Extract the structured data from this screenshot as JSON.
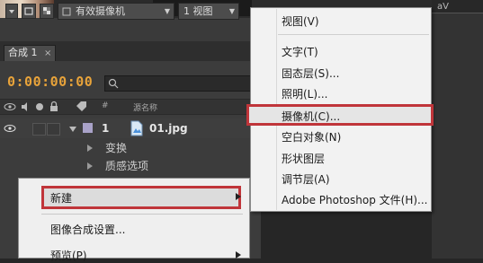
{
  "viewer_toolbar": {
    "camera_select": "有效摄像机",
    "view_select": "1 视图"
  },
  "comp_tab": {
    "label": "合成 1",
    "close": "×"
  },
  "timeline": {
    "timecode": "0:00:00:00",
    "header": {
      "number": "#",
      "source_name": "源名称"
    },
    "layer": {
      "number": "1",
      "name": "01.jpg"
    },
    "sub_items": [
      "变换",
      "质感选项"
    ]
  },
  "context_menu": {
    "items": [
      {
        "label": "新建",
        "has_submenu": true,
        "highlighted": true
      },
      {
        "label": "图像合成设置...",
        "has_submenu": false
      },
      {
        "label": "预览(P)",
        "has_submenu": true
      }
    ]
  },
  "submenu": {
    "items": [
      "视图(V)",
      "文字(T)",
      "固态层(S)...",
      "照明(L)...",
      "摄像机(C)...",
      "空白对象(N)",
      "形状图层",
      "调节层(A)",
      "Adobe Photoshop 文件(H)..."
    ],
    "highlighted_index": 4
  },
  "right_panel": {
    "label": "aV"
  },
  "colors": {
    "highlight_border": "#c0353a",
    "timecode": "#e8a33a"
  }
}
